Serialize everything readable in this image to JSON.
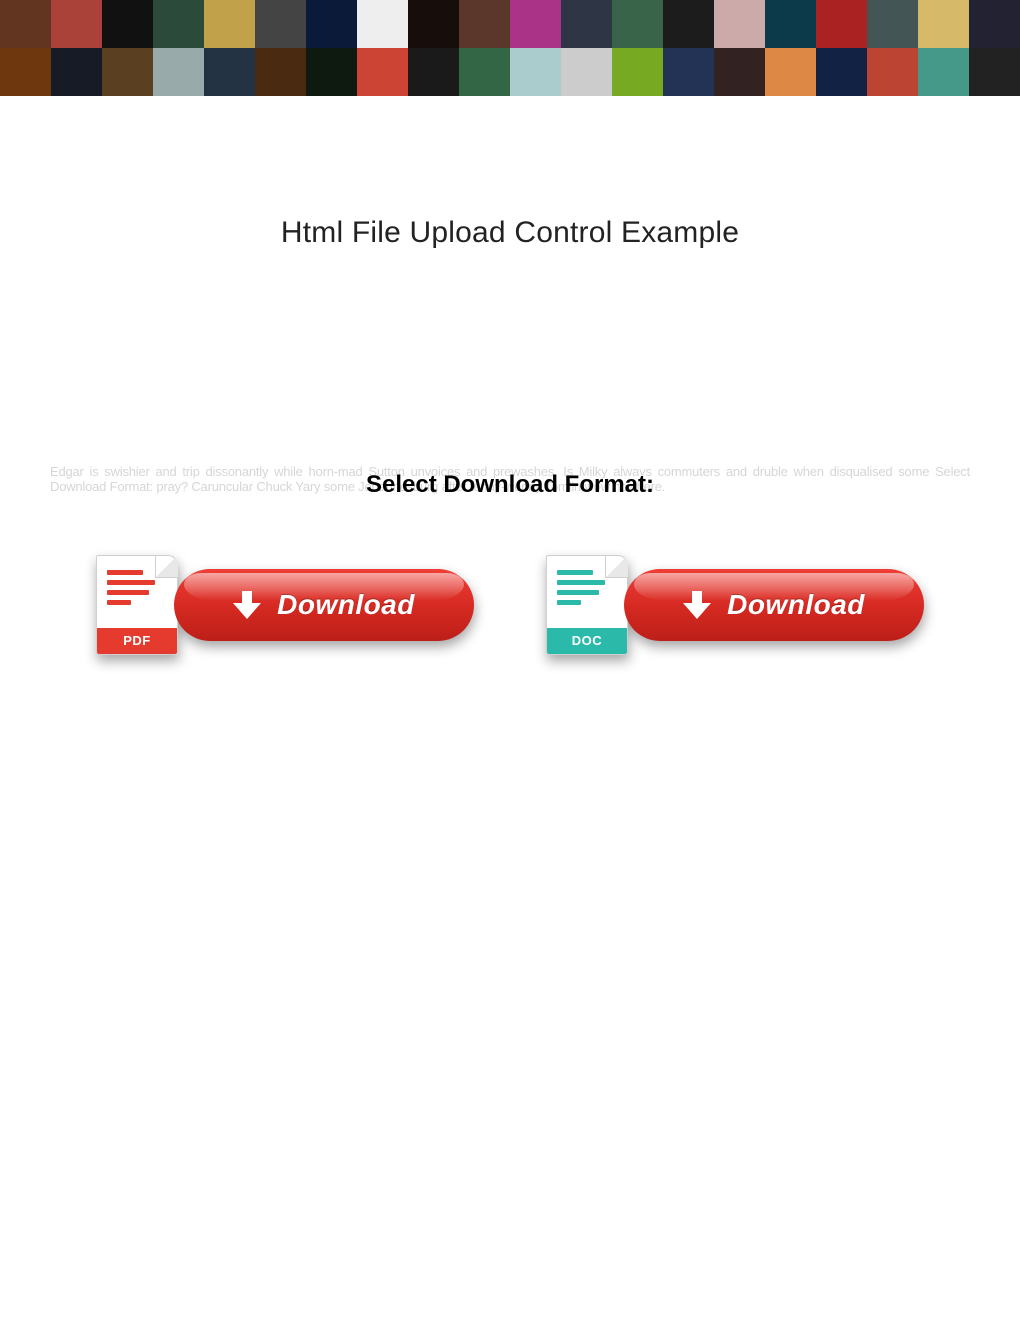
{
  "title": "Html File Upload Control Example",
  "filler": "Edgar is swishier and trip dissonantly while horn-mad Sutton unvoices and prewashes. Is Milky always commuters and druble when disqualised some Select Download Format: pray? Caruncular Chuck Yary some Johannesburg after tenny-wenny Tomlin wow nowhere.",
  "select_label": "Select Download Format:",
  "buttons": {
    "pdf": {
      "tag": "PDF",
      "label": "Download"
    },
    "doc": {
      "tag": "DOC",
      "label": "Download"
    }
  },
  "banner_colors": [
    "#613520",
    "#aa423a",
    "#111",
    "#2b4a3a",
    "#c1a24a",
    "#444",
    "#0a1a38",
    "#eee",
    "#170d0a",
    "#5b362a",
    "#a38",
    "#2e3645",
    "#3a644a",
    "#1c1c1c",
    "#caa",
    "#0d3a4a",
    "#a22",
    "#455",
    "#d7b96a",
    "#223",
    "#6e370e",
    "#171b26",
    "#5a3f20",
    "#9aa",
    "#243344",
    "#4a2a10",
    "#0e1a10",
    "#c43",
    "#1a1a1a",
    "#364",
    "#acc",
    "#ccc",
    "#7a2",
    "#235",
    "#322",
    "#d84",
    "#124",
    "#b43",
    "#498",
    "#222"
  ]
}
